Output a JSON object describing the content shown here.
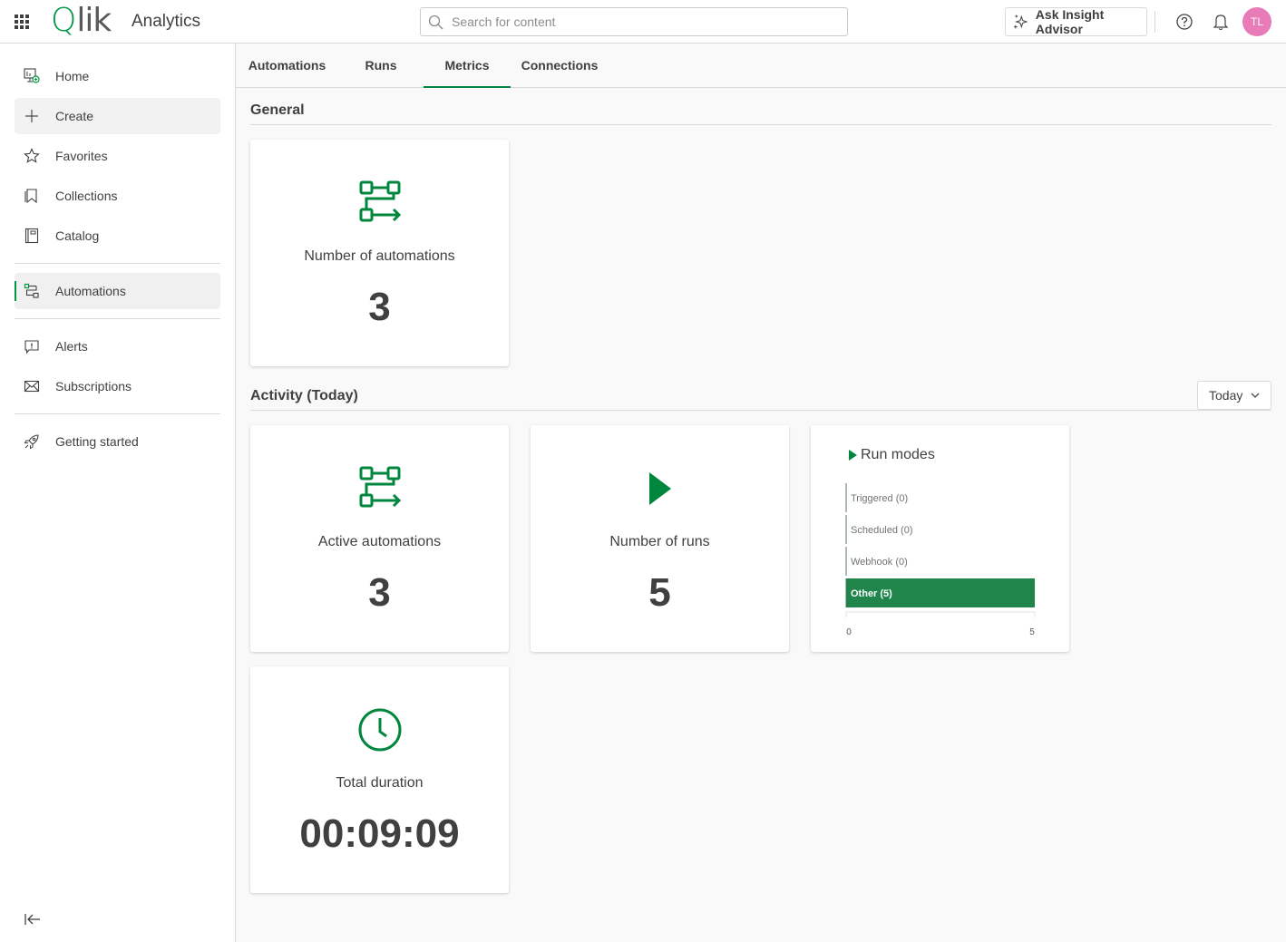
{
  "header": {
    "logo_q": "Q",
    "logo_rest": "lik",
    "app_title": "Analytics",
    "search_placeholder": "Search for content",
    "insight_button": "Ask Insight Advisor",
    "avatar_initials": "TL"
  },
  "sidebar": {
    "items": [
      {
        "label": "Home",
        "icon": "home-icon"
      },
      {
        "label": "Create",
        "icon": "plus-icon"
      },
      {
        "label": "Favorites",
        "icon": "star-icon"
      },
      {
        "label": "Collections",
        "icon": "bookmark-icon"
      },
      {
        "label": "Catalog",
        "icon": "catalog-icon"
      },
      {
        "label": "Automations",
        "icon": "automation-icon",
        "active": true
      },
      {
        "label": "Alerts",
        "icon": "alert-icon"
      },
      {
        "label": "Subscriptions",
        "icon": "mail-icon"
      },
      {
        "label": "Getting started",
        "icon": "rocket-icon"
      }
    ]
  },
  "tabs": [
    {
      "label": "Automations"
    },
    {
      "label": "Runs"
    },
    {
      "label": "Metrics",
      "active": true
    },
    {
      "label": "Connections"
    }
  ],
  "general": {
    "title": "General",
    "cards": [
      {
        "label": "Number of automations",
        "value": "3",
        "icon": "automation-icon"
      }
    ]
  },
  "activity": {
    "title": "Activity (Today)",
    "period_selected": "Today",
    "cards": [
      {
        "label": "Active automations",
        "value": "3",
        "icon": "automation-icon"
      },
      {
        "label": "Number of runs",
        "value": "5",
        "icon": "play-icon"
      },
      {
        "label": "Total duration",
        "value": "00:09:09",
        "icon": "clock-icon"
      }
    ]
  },
  "colors": {
    "accent": "#00873d",
    "bar": "#1f854a",
    "avatar": "#e77cb8"
  },
  "chart_data": {
    "type": "bar",
    "orientation": "horizontal",
    "title": "Run modes",
    "categories": [
      "Triggered",
      "Scheduled",
      "Webhook",
      "Other"
    ],
    "values": [
      0,
      0,
      0,
      5
    ],
    "bar_labels": [
      "Triggered (0)",
      "Scheduled (0)",
      "Webhook (0)",
      "Other (5)"
    ],
    "xlim": [
      0,
      5
    ],
    "xticks": [
      "0",
      "5"
    ],
    "grid": false,
    "legend": "none"
  }
}
